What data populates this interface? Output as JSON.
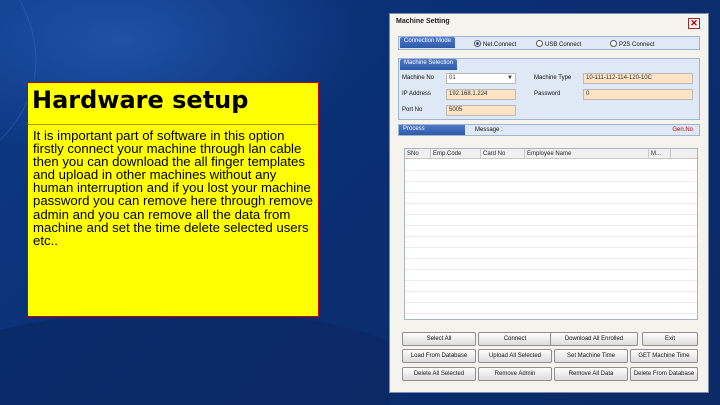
{
  "slide": {
    "heading": "Hardware setup",
    "body": "It is important part of software  in this option firstly connect your machine through lan cable then you can download the all finger templates and upload in other machines without any human interruption and if you lost your machine password you can remove here through remove admin and you can remove all the data from machine and set the time delete selected users etc.."
  },
  "dialog": {
    "title": "Machine Setting",
    "close_glyph": "✕",
    "connection": {
      "label": "Connection Mode",
      "options": [
        {
          "label": "Net.Connect",
          "selected": true
        },
        {
          "label": "USB Connect",
          "selected": false
        },
        {
          "label": "P2S Connect",
          "selected": false
        }
      ]
    },
    "machine": {
      "label": "Machine Selection",
      "machine_no_label": "Machine No",
      "machine_no_value": "01",
      "ip_label": "IP Address",
      "ip_value": "192.168.1.224",
      "port_label": "Port No",
      "port_value": "5005",
      "type_label": "Machine Type",
      "type_value": "10-111-112-114-120-10C",
      "password_label": "Password",
      "password_value": "0"
    },
    "process": {
      "label": "Process",
      "message": "Message :",
      "status": "Gen.No"
    },
    "grid_columns": [
      "SNo",
      "Emp.Code",
      "Card No",
      "Employee Name",
      "M..."
    ],
    "buttons": [
      [
        "Select All",
        "Connect",
        "Download All Enrolled",
        "Exit"
      ],
      [
        "Load From Database",
        "Upload All Selected",
        "Set Machine Time",
        "GET Machine Time"
      ],
      [
        "Delete All Selected",
        "Remove Admin",
        "Remove All Data",
        "Delete From Database"
      ]
    ]
  },
  "colors": {
    "background": "#0b2e6e",
    "card": "#ffff00",
    "card_border": "#c00000",
    "field_fill": "#fde2c4",
    "group_header": "#2e5aa8"
  }
}
